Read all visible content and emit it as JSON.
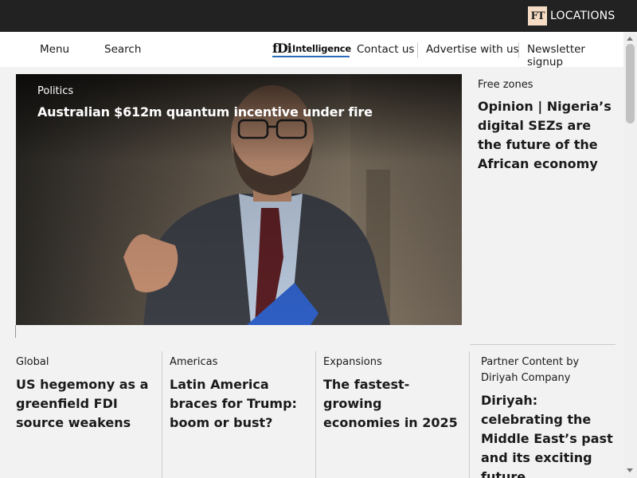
{
  "brand": {
    "ft_mark": "FT",
    "locations": "LOCATIONS"
  },
  "nav": {
    "menu": "Menu",
    "search": "Search",
    "logo_fdi": "fDi",
    "logo_intelligence": "Intelligence",
    "contact": "Contact us",
    "advertise": "Advertise with us",
    "newsletter": "Newsletter signup"
  },
  "hero": {
    "tag": "Politics",
    "title": "Australian $612m quantum incentive under fire"
  },
  "side": {
    "tag": "Free zones",
    "title": "Opinion | Nigeria’s digital SEZs are the future of the African economy"
  },
  "cards": [
    {
      "tag": "Global",
      "title": "US hegemony as a greenfield FDI source weakens"
    },
    {
      "tag": "Americas",
      "title": "Latin America braces for Trump: boom or bust?"
    },
    {
      "tag": "Expansions",
      "title": "The fastest-growing economies in 2025"
    },
    {
      "tag": "Partner Content by Diriyah Company",
      "title": "Diriyah: celebrating the Middle East’s past and its exciting future"
    }
  ],
  "colors": {
    "topbar": "#222222",
    "ft_box": "#f6dcc4",
    "logo_underline": "#2a6ebb",
    "background": "#f2f2f2"
  }
}
